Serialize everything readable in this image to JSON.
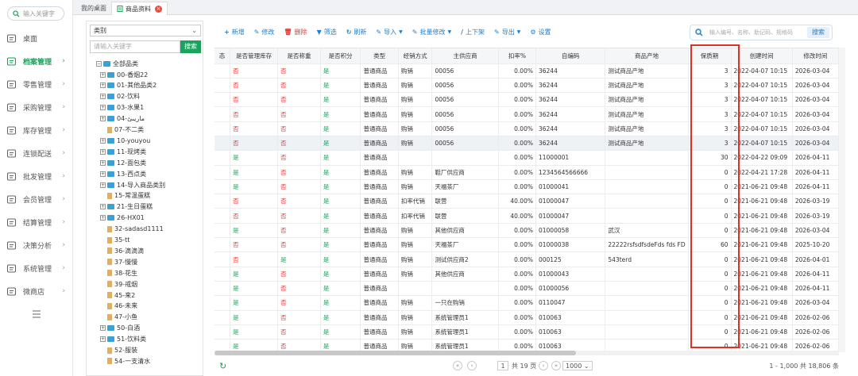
{
  "nav": {
    "search_placeholder": "输入关键字",
    "items": [
      {
        "label": "桌面",
        "icon": "monitor-icon",
        "arrow": false
      },
      {
        "label": "档案管理",
        "icon": "archive-icon",
        "arrow": true,
        "active": true
      },
      {
        "label": "零售管理",
        "icon": "store-icon",
        "arrow": true
      },
      {
        "label": "采购管理",
        "icon": "purchase-icon",
        "arrow": true
      },
      {
        "label": "库存管理",
        "icon": "inventory-icon",
        "arrow": true
      },
      {
        "label": "连锁配送",
        "icon": "delivery-icon",
        "arrow": true
      },
      {
        "label": "批发管理",
        "icon": "wholesale-icon",
        "arrow": true
      },
      {
        "label": "会员管理",
        "icon": "member-icon",
        "arrow": true
      },
      {
        "label": "结算管理",
        "icon": "settlement-icon",
        "arrow": true
      },
      {
        "label": "决策分析",
        "icon": "analysis-icon",
        "arrow": true
      },
      {
        "label": "系统管理",
        "icon": "settings-icon",
        "arrow": true
      },
      {
        "label": "微商店",
        "icon": "shop-icon",
        "arrow": true
      }
    ]
  },
  "tabs": {
    "home": "我的桌面",
    "active": "商品资料",
    "close": "×"
  },
  "category": {
    "select_value": "类别",
    "keyword_placeholder": "请输入关键字",
    "search_button": "搜索",
    "root": "全部品类",
    "nodes": [
      {
        "label": "00-香烟22",
        "folder": true
      },
      {
        "label": "01-其他品类2",
        "folder": true
      },
      {
        "label": "02-饮料",
        "folder": true
      },
      {
        "label": "03-水果1",
        "folder": true
      },
      {
        "label": "04-ماريىئ",
        "folder": true
      },
      {
        "label": "07-不二类",
        "folder": false
      },
      {
        "label": "10-youyou",
        "folder": true
      },
      {
        "label": "11-现烤类",
        "folder": true
      },
      {
        "label": "12-面包类",
        "folder": true
      },
      {
        "label": "13-西点类",
        "folder": true
      },
      {
        "label": "14-导入商品类别",
        "folder": true
      },
      {
        "label": "15-常温蛋糕",
        "folder": false
      },
      {
        "label": "21-生日蛋糕",
        "folder": true
      },
      {
        "label": "26-HX01",
        "folder": true
      },
      {
        "label": "32-sadasd1111",
        "folder": false
      },
      {
        "label": "35-tt",
        "folder": false
      },
      {
        "label": "36-滴滴滴",
        "folder": false
      },
      {
        "label": "37-慢慢",
        "folder": false
      },
      {
        "label": "38-花生",
        "folder": false
      },
      {
        "label": "39-戒烟",
        "folder": false
      },
      {
        "label": "45-来2",
        "folder": false
      },
      {
        "label": "46-未来",
        "folder": false
      },
      {
        "label": "47-小鱼",
        "folder": false
      },
      {
        "label": "50-白酒",
        "folder": true
      },
      {
        "label": "51-饮料类",
        "folder": true
      },
      {
        "label": "52-服装",
        "folder": false
      },
      {
        "label": "54-一支清水",
        "folder": false
      }
    ]
  },
  "toolbar": {
    "add": "新增",
    "edit": "修改",
    "delete": "删除",
    "filter": "筛选",
    "refresh": "刷新",
    "import": "导入",
    "batch_edit": "批量修改",
    "onoff_shelf": "上下架",
    "export": "导出",
    "settings": "设置",
    "search_placeholder": "输入编号、名称、助记码、规格码",
    "search_button": "搜索"
  },
  "table": {
    "columns": [
      "态",
      "是否管理库存",
      "是否称重",
      "是否积分",
      "类型",
      "经销方式",
      "主供应商",
      "扣率%",
      "自编码",
      "商品产地",
      "保质期",
      "创建时间",
      "修改时间"
    ],
    "rows": [
      [
        "",
        "否",
        "否",
        "是",
        "普通商品",
        "购销",
        "00056",
        "0.00%",
        "36244",
        "测试商品产地",
        "3",
        "2022-04-07 10:15",
        "2026-03-04"
      ],
      [
        "",
        "否",
        "否",
        "是",
        "普通商品",
        "购销",
        "00056",
        "0.00%",
        "36244",
        "测试商品产地",
        "3",
        "2022-04-07 10:15",
        "2026-03-04"
      ],
      [
        "",
        "否",
        "否",
        "是",
        "普通商品",
        "购销",
        "00056",
        "0.00%",
        "36244",
        "测试商品产地",
        "3",
        "2022-04-07 10:15",
        "2026-03-04"
      ],
      [
        "",
        "否",
        "否",
        "是",
        "普通商品",
        "购销",
        "00056",
        "0.00%",
        "36244",
        "测试商品产地",
        "3",
        "2022-04-07 10:15",
        "2026-03-04"
      ],
      [
        "",
        "否",
        "否",
        "是",
        "普通商品",
        "购销",
        "00056",
        "0.00%",
        "36244",
        "测试商品产地",
        "3",
        "2022-04-07 10:15",
        "2026-03-04"
      ],
      [
        "",
        "否",
        "否",
        "是",
        "普通商品",
        "购销",
        "00056",
        "0.00%",
        "36244",
        "测试商品产地",
        "3",
        "2022-04-07 10:15",
        "2026-03-04"
      ],
      [
        "",
        "是",
        "否",
        "是",
        "普通商品",
        "",
        "",
        "0.00%",
        "11000001",
        "",
        "30",
        "2022-04-22 09:09",
        "2026-04-11"
      ],
      [
        "",
        "是",
        "否",
        "是",
        "普通商品",
        "购销",
        "鞋厂供应商",
        "0.00%",
        "1234564566666",
        "",
        "0",
        "2022-04-21 17:28",
        "2026-04-11"
      ],
      [
        "",
        "是",
        "否",
        "是",
        "普通商品",
        "购销",
        "天福茶厂",
        "0.00%",
        "01000041",
        "",
        "0",
        "2021-06-21 09:48",
        "2026-04-11"
      ],
      [
        "",
        "否",
        "否",
        "是",
        "普通商品",
        "扣率代销",
        "联营",
        "40.00%",
        "01000047",
        "",
        "0",
        "2021-06-21 09:48",
        "2026-03-19"
      ],
      [
        "",
        "否",
        "否",
        "是",
        "普通商品",
        "扣率代销",
        "联营",
        "40.00%",
        "01000047",
        "",
        "0",
        "2021-06-21 09:48",
        "2026-03-19"
      ],
      [
        "",
        "是",
        "否",
        "是",
        "普通商品",
        "购销",
        "其他供应商",
        "0.00%",
        "01000058",
        "武汉",
        "0",
        "2021-06-21 09:48",
        "2026-03-04"
      ],
      [
        "",
        "否",
        "否",
        "是",
        "普通商品",
        "购销",
        "天福茶厂",
        "0.00%",
        "01000038",
        "22222rsfsdfsdeFds fds FD",
        "60",
        "2021-06-21 09:48",
        "2025-10-20"
      ],
      [
        "",
        "否",
        "是",
        "是",
        "普通商品",
        "购销",
        "测试供应商2",
        "0.00%",
        "000125",
        "543terd",
        "0",
        "2021-06-21 09:48",
        "2026-04-01"
      ],
      [
        "",
        "是",
        "否",
        "是",
        "普通商品",
        "购销",
        "其他供应商",
        "0.00%",
        "01000043",
        "",
        "0",
        "2021-06-21 09:48",
        "2026-04-11"
      ],
      [
        "",
        "是",
        "否",
        "是",
        "普通商品",
        "",
        "",
        "0.00%",
        "01000056",
        "",
        "0",
        "2021-06-21 09:48",
        "2026-04-11"
      ],
      [
        "",
        "是",
        "否",
        "是",
        "普通商品",
        "购销",
        "一只在购销",
        "0.00%",
        "0110047",
        "",
        "0",
        "2021-06-21 09:48",
        "2026-03-04"
      ],
      [
        "",
        "是",
        "否",
        "是",
        "普通商品",
        "购销",
        "系统管理员1",
        "0.00%",
        "010063",
        "",
        "0",
        "2021-06-21 09:48",
        "2026-02-06"
      ],
      [
        "",
        "是",
        "否",
        "是",
        "普通商品",
        "购销",
        "系统管理员1",
        "0.00%",
        "010063",
        "",
        "0",
        "2021-06-21 09:48",
        "2026-02-06"
      ],
      [
        "",
        "是",
        "否",
        "是",
        "普通商品",
        "购销",
        "系统管理员1",
        "0.00%",
        "010063",
        "",
        "0",
        "2021-06-21 09:48",
        "2026-02-06"
      ]
    ]
  },
  "footer": {
    "page": "1",
    "total_pages": "共 19 页",
    "page_size": "1000",
    "range": "1 - 1,000  共 18,806 条"
  },
  "colors": {
    "accent": "#1aa35c",
    "link": "#1f7ecf",
    "no": "#e23b3b",
    "highlight_box": "#e0301e"
  }
}
